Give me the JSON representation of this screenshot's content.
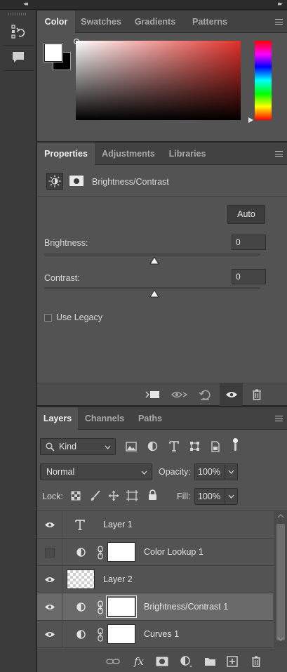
{
  "color_panel": {
    "tabs": [
      "Color",
      "Swatches",
      "Gradients",
      "Patterns"
    ],
    "active_tab": "Color",
    "foreground_color": "#ffffff",
    "background_color": "#000000",
    "picker_hue": "#e2302a"
  },
  "properties_panel": {
    "tabs": [
      "Properties",
      "Adjustments",
      "Libraries"
    ],
    "active_tab": "Properties",
    "adjustment_title": "Brightness/Contrast",
    "auto_label": "Auto",
    "brightness_label": "Brightness:",
    "brightness_value": "0",
    "contrast_label": "Contrast:",
    "contrast_value": "0",
    "use_legacy_label": "Use Legacy",
    "use_legacy_checked": false
  },
  "layers_panel": {
    "tabs": [
      "Layers",
      "Channels",
      "Paths"
    ],
    "active_tab": "Layers",
    "filter_kind": "Kind",
    "blend_mode": "Normal",
    "opacity_label": "Opacity:",
    "opacity_value": "100%",
    "lock_label": "Lock:",
    "fill_label": "Fill:",
    "fill_value": "100%",
    "layers": [
      {
        "name": "Layer 1",
        "type": "text",
        "visible": true,
        "selected": false
      },
      {
        "name": "Color Lookup 1",
        "type": "adjustment",
        "visible": false,
        "selected": false
      },
      {
        "name": "Layer 2",
        "type": "pixel",
        "visible": true,
        "selected": false
      },
      {
        "name": "Brightness/Contrast 1",
        "type": "adjustment",
        "visible": true,
        "selected": true
      },
      {
        "name": "Curves 1",
        "type": "adjustment",
        "visible": true,
        "selected": false
      }
    ],
    "bottom_fx_label": "fx"
  }
}
